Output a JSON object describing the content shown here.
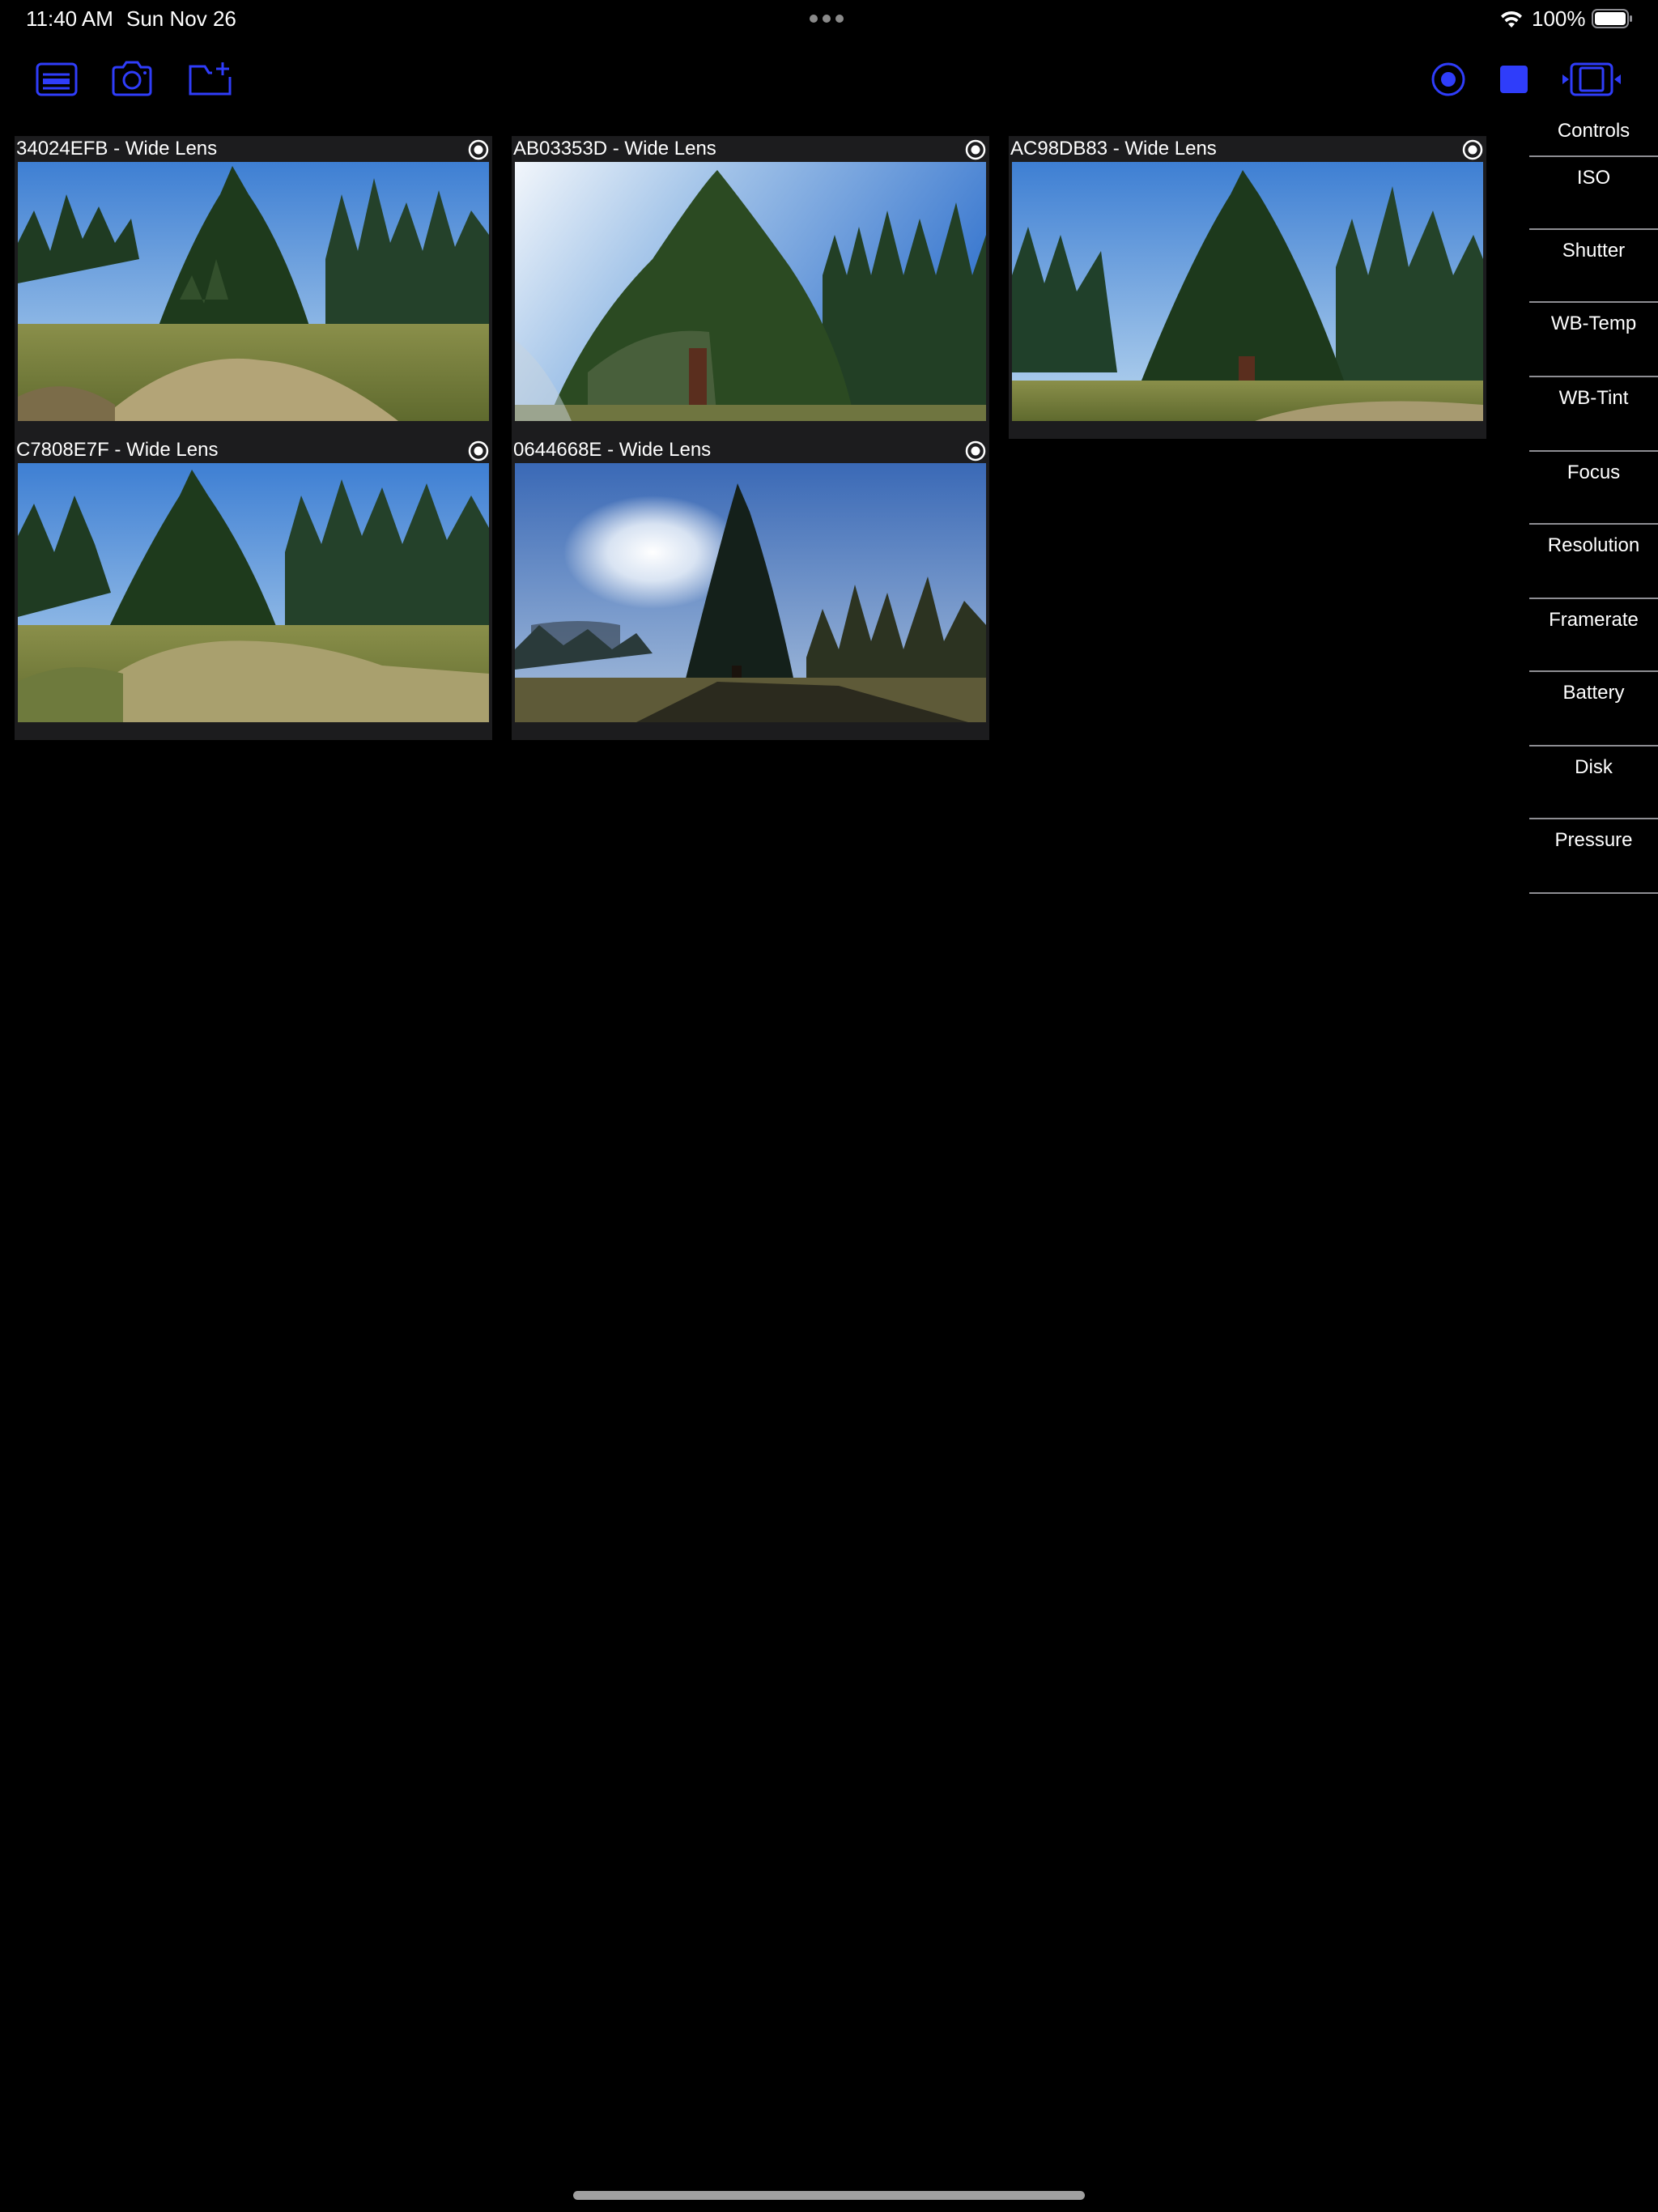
{
  "status_bar": {
    "time": "11:40 AM",
    "date": "Sun Nov 26",
    "battery": "100%"
  },
  "toolbar": {
    "left": [
      "card-icon",
      "camera-icon",
      "folder-plus-icon"
    ],
    "right": [
      "record-icon",
      "stop-icon",
      "video-frame-icon"
    ],
    "accent_color": "#2f3dfa"
  },
  "tiles": [
    {
      "title": "34024EFB - Wide Lens",
      "scene": "meadow-tree-mound"
    },
    {
      "title": "AB03353D - Wide Lens",
      "scene": "sequoia-sun"
    },
    {
      "title": "AC98DB83 - Wide Lens",
      "scene": "meadow-tree-wide"
    },
    {
      "title": "C7808E7F - Wide Lens",
      "scene": "meadow-tree-mound"
    },
    {
      "title": "0644668E - Wide Lens",
      "scene": "silhouette-tree"
    }
  ],
  "controls": {
    "title": "Controls",
    "items": [
      "ISO",
      "Shutter",
      "WB-Temp",
      "WB-Tint",
      "Focus",
      "Resolution",
      "Framerate",
      "Battery",
      "Disk",
      "Pressure"
    ]
  }
}
